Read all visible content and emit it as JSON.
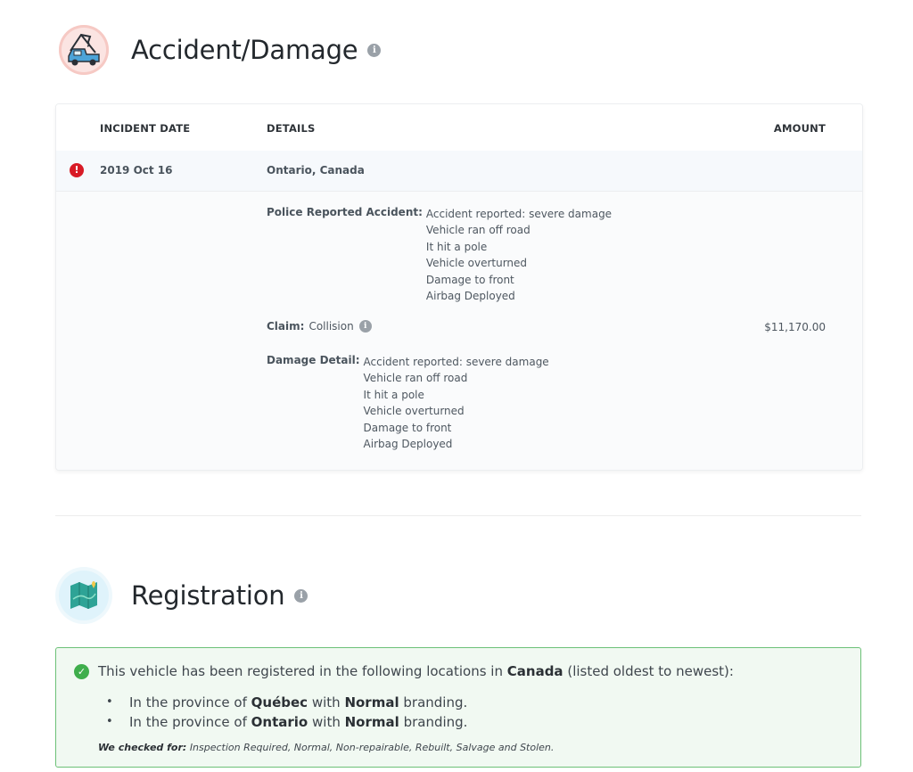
{
  "accident_section": {
    "title": "Accident/Damage",
    "icon": "tow-truck-icon",
    "table": {
      "headers": {
        "date": "INCIDENT DATE",
        "details": "DETAILS",
        "amount": "AMOUNT"
      },
      "record": {
        "status_icon": "alert-icon",
        "status_color": "#d81b26",
        "date": "2019 Oct 16",
        "location": "Ontario, Canada",
        "police_report": {
          "label": "Police Reported Accident:",
          "lines": [
            "Accident reported: severe damage",
            "Vehicle ran off road",
            "It hit a pole",
            "Vehicle overturned",
            "Damage to front",
            "Airbag Deployed"
          ]
        },
        "claim": {
          "label": "Claim:",
          "value": "Collision",
          "amount": "$11,170.00"
        },
        "damage_detail": {
          "label": "Damage Detail:",
          "lines": [
            "Accident reported: severe damage",
            "Vehicle ran off road",
            "It hit a pole",
            "Vehicle overturned",
            "Damage to front",
            "Airbag Deployed"
          ]
        }
      }
    }
  },
  "registration_section": {
    "title": "Registration",
    "icon": "map-icon",
    "intro": {
      "prefix": "This vehicle has been registered in the following locations in",
      "country": "Canada",
      "suffix": "(listed oldest to newest):"
    },
    "entries": [
      {
        "prefix": "In the province of",
        "province": "Québec",
        "mid": "with",
        "branding": "Normal",
        "suffix": "branding."
      },
      {
        "prefix": "In the province of",
        "province": "Ontario",
        "mid": "with",
        "branding": "Normal",
        "suffix": "branding."
      }
    ],
    "checked_for": {
      "label": "We checked for:",
      "value": "Inspection Required, Normal, Non-repairable, Rebuilt, Salvage and Stolen."
    },
    "box_border_color": "#6cc177"
  }
}
